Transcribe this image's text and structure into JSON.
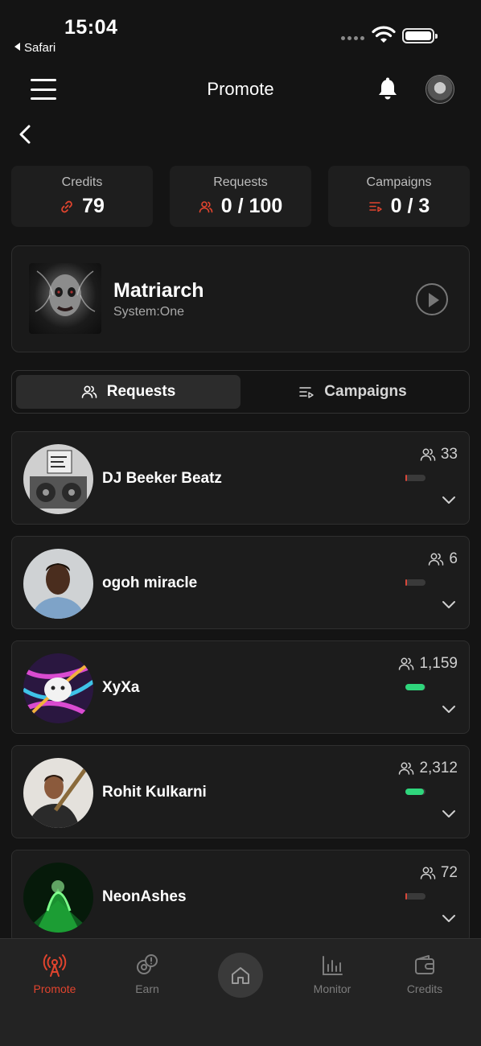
{
  "status_bar": {
    "time": "15:04",
    "back_app": "Safari"
  },
  "header": {
    "title": "Promote"
  },
  "stats": [
    {
      "label": "Credits",
      "value": "79",
      "icon": "link-icon"
    },
    {
      "label": "Requests",
      "value": "0 / 100",
      "icon": "users-icon"
    },
    {
      "label": "Campaigns",
      "value": "0 / 3",
      "icon": "playlist-icon"
    }
  ],
  "track": {
    "title": "Matriarch",
    "artist": "System:One"
  },
  "tabs": [
    {
      "label": "Requests",
      "active": true
    },
    {
      "label": "Campaigns",
      "active": false
    }
  ],
  "curators": [
    {
      "name": "DJ Beeker Beatz",
      "followers": "33",
      "level": 0.1
    },
    {
      "name": "ogoh miracle",
      "followers": "6",
      "level": 0.05
    },
    {
      "name": "XyXa",
      "followers": "1,159",
      "level": 0.95
    },
    {
      "name": "Rohit Kulkarni",
      "followers": "2,312",
      "level": 0.9
    },
    {
      "name": "NeonAshes",
      "followers": "72",
      "level": 0.1
    }
  ],
  "bottom_nav": [
    {
      "label": "Promote",
      "active": true
    },
    {
      "label": "Earn",
      "active": false
    },
    {
      "label": "Monitor",
      "active": false
    },
    {
      "label": "Credits",
      "active": false
    }
  ],
  "colors": {
    "accent": "#e0442e",
    "level_high": "#2fd67c",
    "level_low": "#3a3a3a"
  }
}
